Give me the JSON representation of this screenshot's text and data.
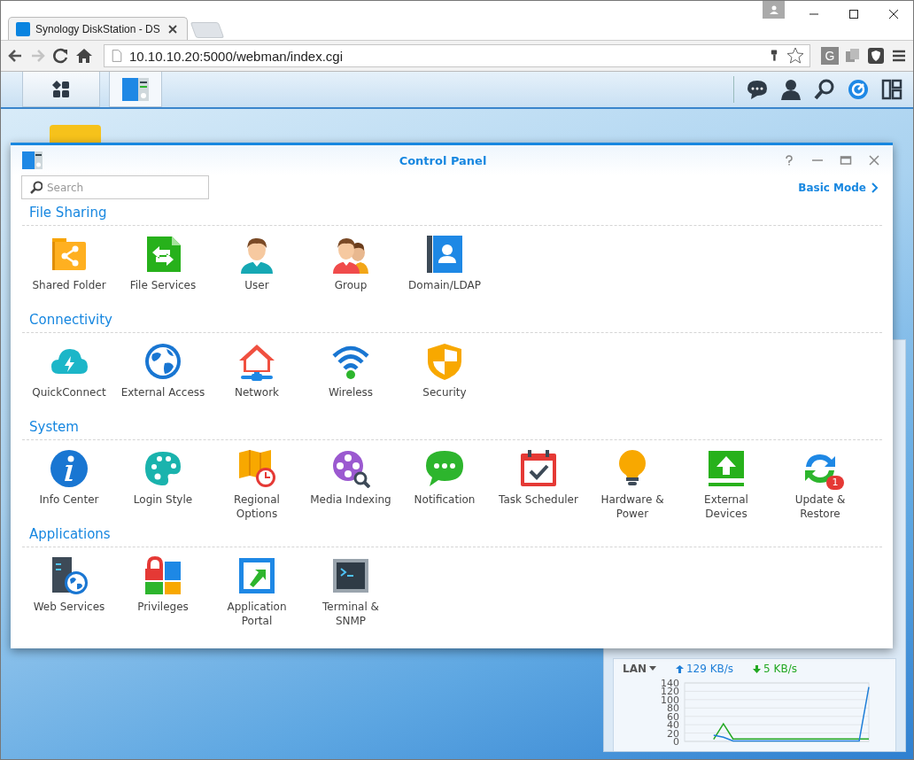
{
  "browser": {
    "tab": {
      "title": "Synology DiskStation - DS",
      "selected": true
    },
    "url": "10.10.10.20:5000/webman/index.cgi",
    "forward_disabled": true,
    "extension_label": "G"
  },
  "taskbar": {
    "apps": [
      {
        "kind": "main-menu",
        "selected": false
      },
      {
        "kind": "control-panel",
        "selected": true
      }
    ]
  },
  "control_panel": {
    "title": "Control Panel",
    "search": {
      "placeholder": "Search"
    },
    "mode_link": "Basic Mode",
    "sections": [
      {
        "heading": "File Sharing",
        "items": [
          {
            "label": "Shared Folder"
          },
          {
            "label": "File Services"
          },
          {
            "label": "User"
          },
          {
            "label": "Group"
          },
          {
            "label": "Domain/LDAP"
          }
        ]
      },
      {
        "heading": "Connectivity",
        "items": [
          {
            "label": "QuickConnect"
          },
          {
            "label": "External Access"
          },
          {
            "label": "Network"
          },
          {
            "label": "Wireless"
          },
          {
            "label": "Security"
          }
        ]
      },
      {
        "heading": "System",
        "items": [
          {
            "label": "Info Center"
          },
          {
            "label": "Login Style"
          },
          {
            "label": "Regional Options"
          },
          {
            "label": "Media Indexing"
          },
          {
            "label": "Notification"
          },
          {
            "label": "Task Scheduler"
          },
          {
            "label": "Hardware & Power"
          },
          {
            "label": "External Devices"
          },
          {
            "label": "Update & Restore",
            "badge": "1"
          }
        ]
      },
      {
        "heading": "Applications",
        "items": [
          {
            "label": "Web Services"
          },
          {
            "label": "Privileges"
          },
          {
            "label": "Application Portal"
          },
          {
            "label": "Terminal & SNMP"
          }
        ]
      }
    ]
  },
  "network_widget": {
    "interface": "LAN",
    "upload": "129 KB/s",
    "download": "5 KB/s",
    "chart_data": {
      "type": "line",
      "grid": true,
      "ylim": [
        0,
        140
      ],
      "yticks": [
        0,
        20,
        40,
        60,
        80,
        100,
        120,
        140
      ],
      "series": [
        {
          "color": "#1f7fd8",
          "values": [
            null,
            null,
            null,
            15,
            10,
            1,
            1,
            1,
            1,
            1,
            1,
            1,
            1,
            1,
            1,
            1,
            1,
            1,
            1,
            130
          ]
        },
        {
          "color": "#22a822",
          "values": [
            null,
            null,
            null,
            5,
            42,
            6,
            6,
            6,
            6,
            6,
            6,
            6,
            6,
            6,
            6,
            6,
            6,
            6,
            6,
            6
          ]
        }
      ]
    }
  }
}
